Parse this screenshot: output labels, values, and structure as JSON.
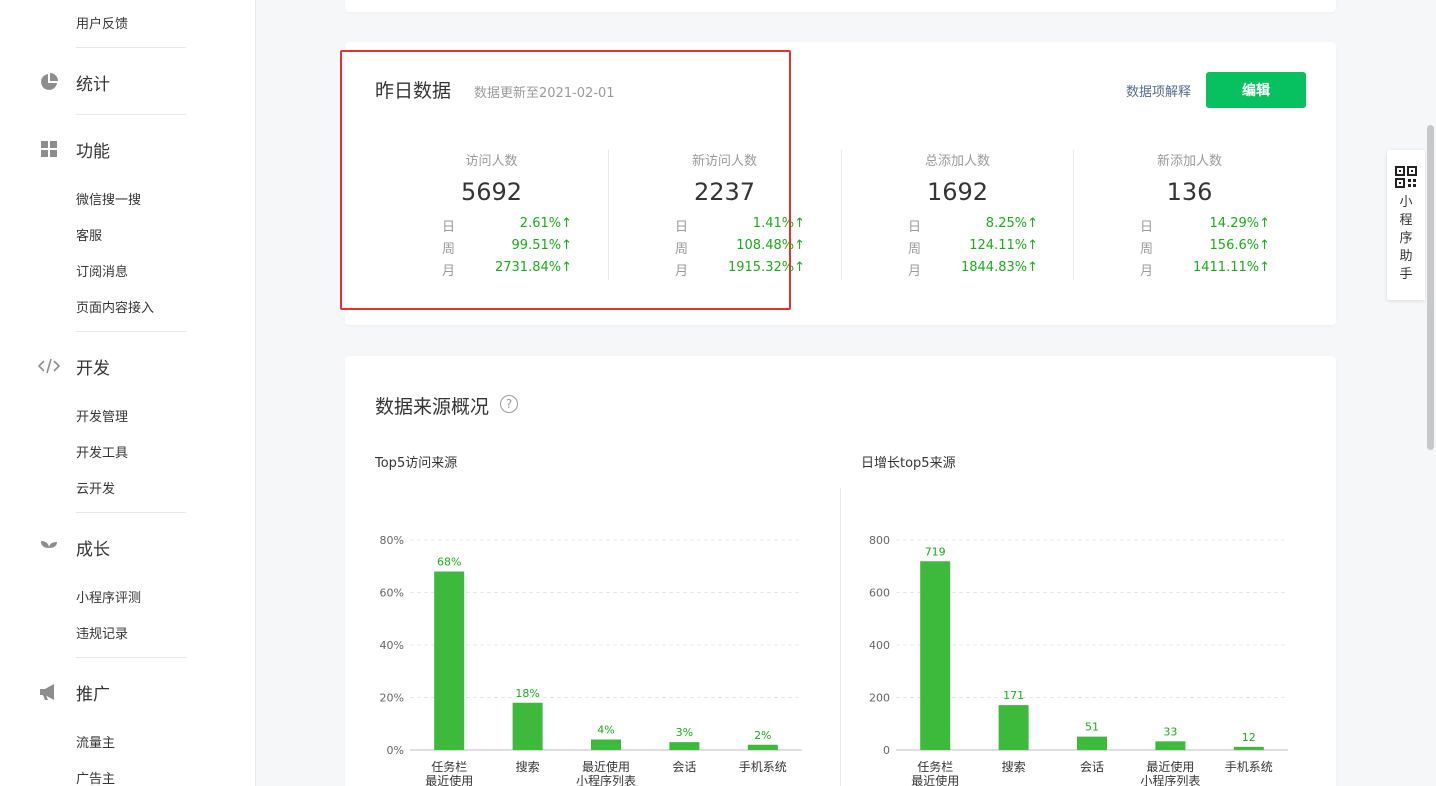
{
  "sidebar": {
    "top_item": "用户反馈",
    "sections": [
      {
        "title": "统计",
        "icon": "pie-chart-icon",
        "items": []
      },
      {
        "title": "功能",
        "icon": "grid-icon",
        "items": [
          "微信搜一搜",
          "客服",
          "订阅消息",
          "页面内容接入"
        ]
      },
      {
        "title": "开发",
        "icon": "code-icon",
        "items": [
          "开发管理",
          "开发工具",
          "云开发"
        ]
      },
      {
        "title": "成长",
        "icon": "sprout-icon",
        "items": [
          "小程序评测",
          "违规记录"
        ]
      },
      {
        "title": "推广",
        "icon": "megaphone-icon",
        "items": [
          "流量主",
          "广告主"
        ]
      }
    ]
  },
  "yesterday": {
    "title": "昨日数据",
    "subtitle": "数据更新至2021-02-01",
    "explain_link": "数据项解释",
    "edit_button": "编辑",
    "metrics": [
      {
        "label": "访问人数",
        "value": "5692",
        "rows": [
          {
            "k": "日",
            "v": "2.61%↑"
          },
          {
            "k": "周",
            "v": "99.51%↑"
          },
          {
            "k": "月",
            "v": "2731.84%↑"
          }
        ]
      },
      {
        "label": "新访问人数",
        "value": "2237",
        "rows": [
          {
            "k": "日",
            "v": "1.41%↑"
          },
          {
            "k": "周",
            "v": "108.48%↑"
          },
          {
            "k": "月",
            "v": "1915.32%↑"
          }
        ]
      },
      {
        "label": "总添加人数",
        "value": "1692",
        "rows": [
          {
            "k": "日",
            "v": "8.25%↑"
          },
          {
            "k": "周",
            "v": "124.11%↑"
          },
          {
            "k": "月",
            "v": "1844.83%↑"
          }
        ]
      },
      {
        "label": "新添加人数",
        "value": "136",
        "rows": [
          {
            "k": "日",
            "v": "14.29%↑"
          },
          {
            "k": "周",
            "v": "156.6%↑"
          },
          {
            "k": "月",
            "v": "1411.11%↑"
          }
        ]
      }
    ],
    "highlight_color": "#e5322d",
    "accent_color": "#07c160",
    "up_color": "#1aad19"
  },
  "source": {
    "title": "数据来源概况",
    "help_icon": "question-circle-icon",
    "help_glyph": "?"
  },
  "helper": {
    "icon": "qr-code-icon",
    "text": "小程序助手"
  },
  "chart_data": [
    {
      "type": "bar",
      "title": "Top5访问来源",
      "categories": [
        "任务栏最近使用",
        "搜索",
        "最近使用小程序列表",
        "会话",
        "手机系统"
      ],
      "category_label_lines": [
        [
          "任务栏",
          "最近使用"
        ],
        [
          "搜索"
        ],
        [
          "最近使用",
          "小程序列表"
        ],
        [
          "会话"
        ],
        [
          "手机系统"
        ]
      ],
      "values": [
        68,
        18,
        4,
        3,
        2
      ],
      "value_labels": [
        "68%",
        "18%",
        "4%",
        "3%",
        "2%"
      ],
      "yticks": [
        "0%",
        "20%",
        "40%",
        "60%",
        "80%"
      ],
      "ylim": [
        0,
        80
      ],
      "grid": true,
      "bar_color": "#3db93c"
    },
    {
      "type": "bar",
      "title": "日增长top5来源",
      "categories": [
        "任务栏最近使用",
        "搜索",
        "会话",
        "最近使用小程序列表",
        "手机系统"
      ],
      "category_label_lines": [
        [
          "任务栏",
          "最近使用"
        ],
        [
          "搜索"
        ],
        [
          "会话"
        ],
        [
          "最近使用",
          "小程序列表"
        ],
        [
          "手机系统"
        ]
      ],
      "values": [
        719,
        171,
        51,
        33,
        12
      ],
      "value_labels": [
        "719",
        "171",
        "51",
        "33",
        "12"
      ],
      "yticks": [
        "0",
        "200",
        "400",
        "600",
        "800"
      ],
      "ylim": [
        0,
        800
      ],
      "grid": true,
      "bar_color": "#3db93c"
    }
  ]
}
